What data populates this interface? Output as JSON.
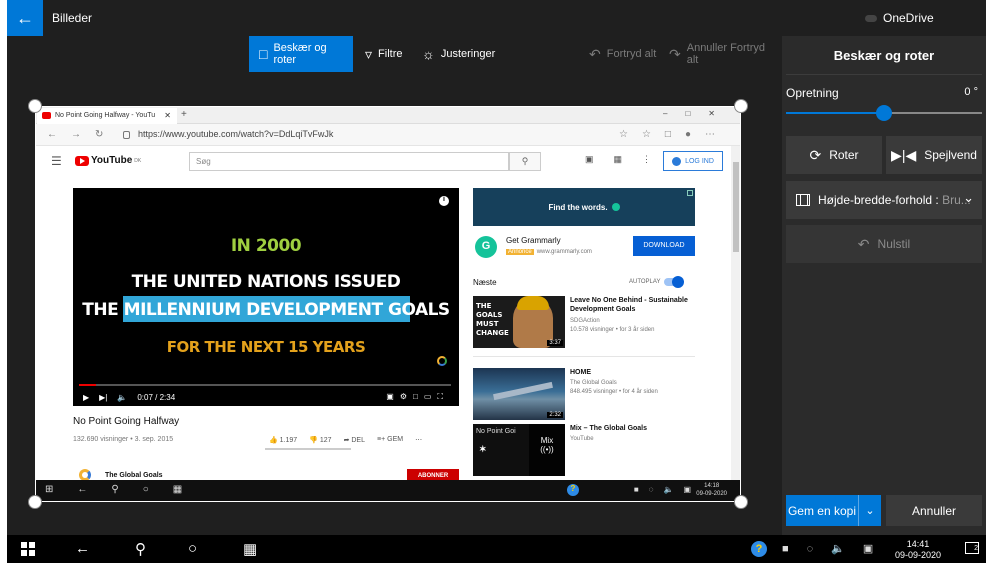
{
  "app": {
    "title": "Billeder",
    "onedrive": "OneDrive",
    "back_icon": "arrow-left-icon"
  },
  "toolbar": {
    "crop": "Beskær og roter",
    "filters": "Filtre",
    "adjust": "Justeringer",
    "undo": "Fortryd alt",
    "redo": "Annuller Fortryd alt"
  },
  "panel": {
    "title": "Beskær og roter",
    "orientation_label": "Opretning",
    "orientation_value": "0 °",
    "orientation_slider": 0.5,
    "rotate": "Roter",
    "flip": "Spejlvend",
    "aspect_label": "Højde-bredde-forhold : ",
    "aspect_value": "Bru...",
    "reset": "Nulstil",
    "save_copy": "Gem en kopi",
    "cancel": "Annuller"
  },
  "browser": {
    "tab_title": "No Point Going Halfway - YouTu",
    "url": "https://www.youtube.com/watch?v=DdLqiTvFwJk",
    "search_placeholder": "Søg",
    "logo": "YouTube",
    "logo_sup": "DK",
    "login": "LOG IND"
  },
  "video": {
    "line1": "IN 2000",
    "line2": "THE UNITED NATIONS ISSUED",
    "line3": "THE MILLENNIUM DEVELOPMENT GOALS",
    "line4": "FOR THE NEXT 15 YEARS",
    "time": "0:07 / 2:34",
    "title": "No Point Going Halfway",
    "meta": "132.690 visninger • 3. sep. 2015",
    "likes": "1.197",
    "dislikes": "127",
    "share": "DEL",
    "save": "GEM",
    "channel": "The Global Goals",
    "subscribe": "ABONNER",
    "progress": 0.045
  },
  "sidebar": {
    "ad_text": "Find the words.",
    "ad_name": "Get Grammarly",
    "ad_badge": "Annonce",
    "ad_url": "www.grammarly.com",
    "ad_button": "DOWNLOAD",
    "next_label": "Næste",
    "autoplay": "AUTOPLAY",
    "recs": [
      {
        "title": "Leave No One Behind - Sustainable Development Goals",
        "channel": "SDGAction",
        "views": "10.578 visninger • for 3 år siden",
        "duration": "3:37",
        "thumb_text": "THE GOALS MUST CHANGE"
      },
      {
        "title": "HOME",
        "channel": "The Global Goals",
        "views": "848.495 visninger • for 4 år siden",
        "duration": "2:32"
      },
      {
        "title": "Mix – The Global Goals",
        "channel": "YouTube",
        "views": "",
        "duration": "",
        "thumb_text": "No Point Goi",
        "mix": "Mix"
      }
    ]
  },
  "inner_taskbar": {
    "time": "14:18",
    "date": "09-09-2020"
  },
  "os_taskbar": {
    "time": "14:41",
    "date": "09-09-2020",
    "notifications": "2"
  },
  "colors": {
    "accent": "#0078d7",
    "background": "#1f1f1f",
    "panel": "#2b2b2b"
  }
}
